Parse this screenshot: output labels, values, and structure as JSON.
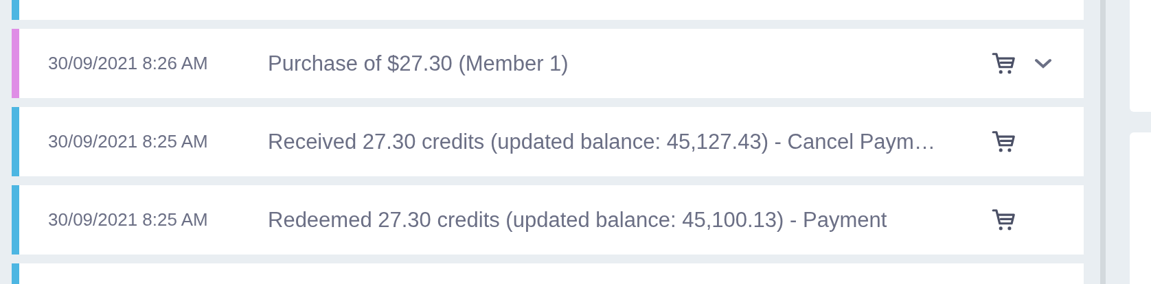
{
  "transactions": [
    {
      "color": "#4db6e2"
    },
    {
      "color": "#df8ee6",
      "date": "30/09/2021 8:26 AM",
      "description": "Purchase of $27.30 (Member 1)",
      "expandable": true
    },
    {
      "color": "#4db6e2",
      "date": "30/09/2021 8:25 AM",
      "description": "Received 27.30 credits (updated balance: 45,127.43) - Cancel Paym…",
      "expandable": false
    },
    {
      "color": "#4db6e2",
      "date": "30/09/2021 8:25 AM",
      "description": "Redeemed 27.30 credits (updated balance: 45,100.13) - Payment",
      "expandable": false
    },
    {
      "color": "#4db6e2"
    }
  ]
}
